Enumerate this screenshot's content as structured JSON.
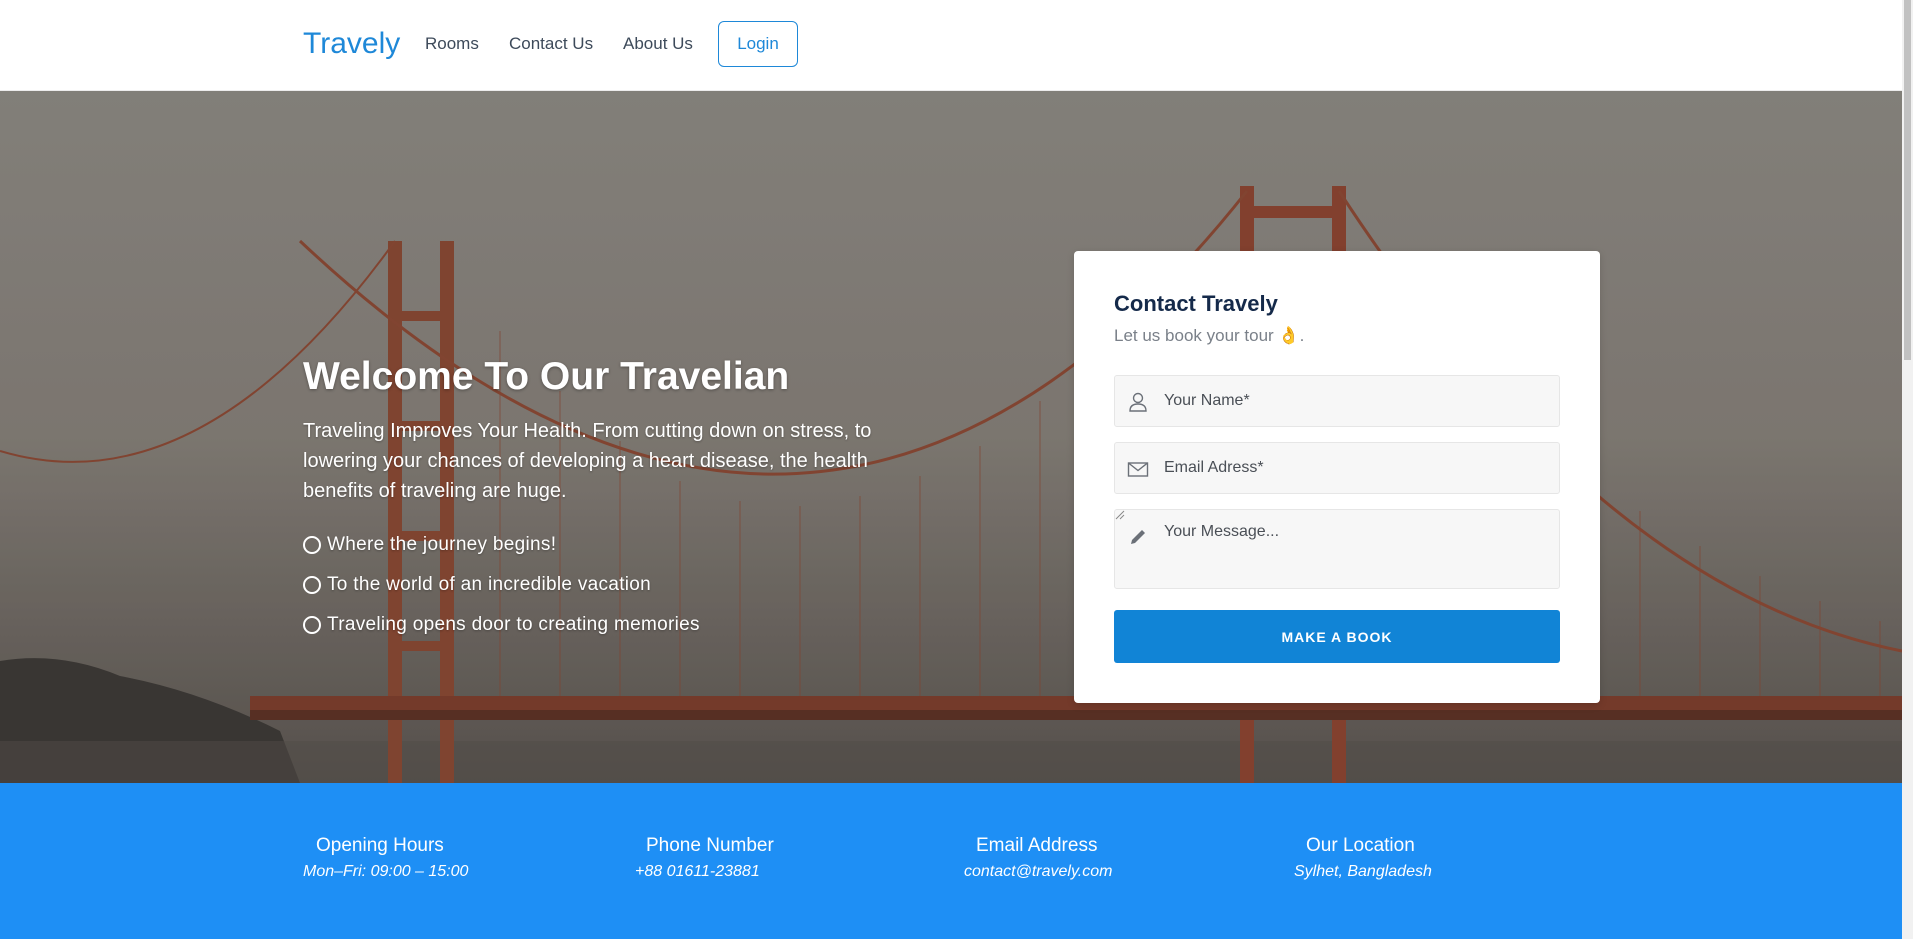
{
  "nav": {
    "brand": "Travely",
    "links": [
      "Rooms",
      "Contact Us",
      "About Us"
    ],
    "login_label": "Login"
  },
  "hero": {
    "title": "Welcome To Our Travelian",
    "description": "Traveling Improves Your Health. From cutting down on stress, to lowering your chances of developing a heart disease, the health benefits of traveling are huge.",
    "features": [
      "Where the journey begins!",
      "To the world of an incredible vacation",
      "Traveling opens door to creating memories"
    ]
  },
  "contact_form": {
    "title": "Contact Travely",
    "subtitle": "Let us book your tour 👌.",
    "name_placeholder": "Your Name*",
    "email_placeholder": "Email Adress*",
    "message_placeholder": "Your Message...",
    "submit_label": "MAKE A BOOK"
  },
  "info": [
    {
      "title": "Opening Hours",
      "value": "Mon–Fri: 09:00 – 15:00"
    },
    {
      "title": "Phone Number",
      "value": "+88 01611-23881"
    },
    {
      "title": "Email Address",
      "value": "contact@travely.com"
    },
    {
      "title": "Our Location",
      "value": "Sylhet, Bangladesh"
    }
  ],
  "colors": {
    "brand": "#1e88d8",
    "button": "#1184d6",
    "info_strip": "#1e8ff5"
  },
  "icons": [
    "user-icon",
    "envelope-icon",
    "pencil-icon",
    "circle-bullet-icon"
  ]
}
